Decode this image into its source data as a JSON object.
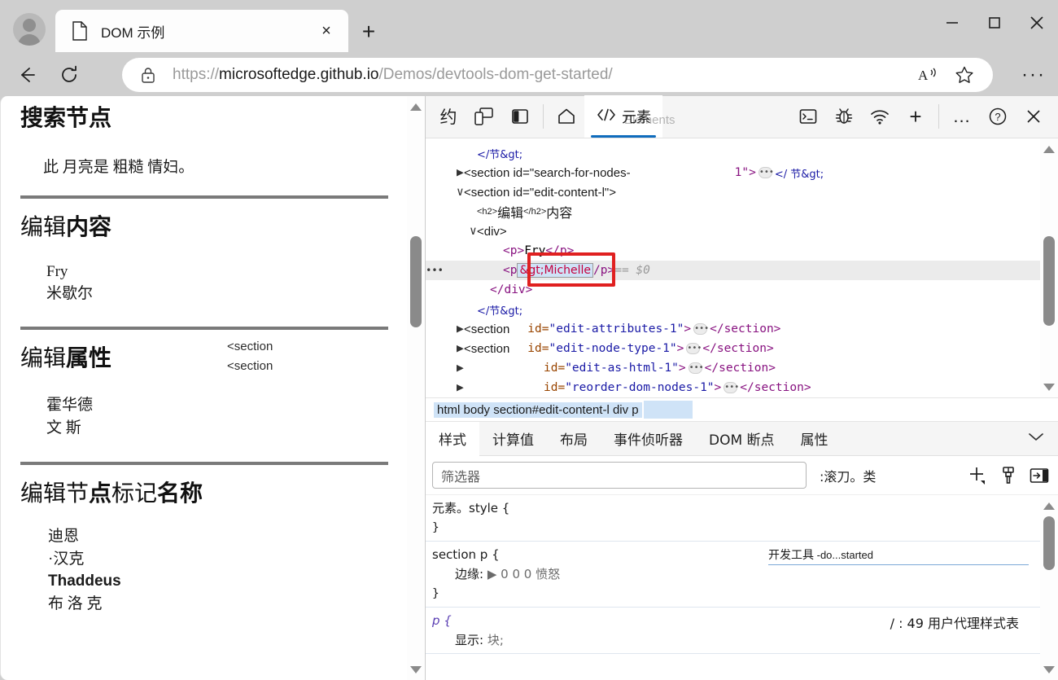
{
  "window": {
    "minimize_label": "minimize",
    "maximize_label": "maximize",
    "close_label": "close"
  },
  "tab": {
    "title": "DOM 示例",
    "close_label": "×",
    "new_tab_label": "+"
  },
  "address_bar": {
    "url_prefix": "https://",
    "url_host": "microsoftedge.github.io",
    "url_path": "/Demos/devtools-dom-get-started/",
    "read_aloud_icon": "read-aloud-icon",
    "favorite_icon": "star-icon",
    "settings_icon": "ellipsis-icon"
  },
  "page": {
    "sections": [
      {
        "heading": "搜索节点",
        "paragraph": "此    月亮是       粗糙    情妇。",
        "lines": []
      },
      {
        "heading_light": "编辑",
        "heading_bold": "内容",
        "lines": [
          "Fry",
          "米歇尔"
        ]
      },
      {
        "heading_light": "编辑",
        "heading_bold": "属性",
        "ghost_labels": [
          "<section",
          "<section"
        ],
        "lines": [
          "霍华德",
          "文 斯"
        ]
      },
      {
        "heading_light": "编辑节",
        "heading_bold2": "点",
        "heading_light2": "标记",
        "heading_bold3": "名称",
        "lines": [
          "迪恩",
          "·汉克",
          "Thaddeus",
          "布 洛 克"
        ]
      }
    ]
  },
  "devtools": {
    "toolbar": {
      "about_label": "约",
      "device_emulation_icon": "device-emulation-icon",
      "dock_side_icon": "dock-side-icon",
      "home_icon": "home-icon",
      "elements_tab_label": "元素",
      "elements_tab_ghost": "Elements",
      "console_icon": "console-icon",
      "debugger_icon": "bug-icon",
      "network_icon": "network-icon",
      "add_tool_label": "+",
      "more_label": "...",
      "help_label": "?",
      "close_label": "×"
    },
    "dom": {
      "rows": [
        {
          "indent": 2,
          "twisty": "",
          "parts": [
            {
              "t": "cn-blue",
              "v": "</节&gt;"
            }
          ]
        },
        {
          "indent": 1,
          "twisty": "▶",
          "parts": [
            {
              "t": "tag",
              "v": "<section id=\"search-for-nodes-"
            },
            {
              "t": "spacer",
              "v": ""
            },
            {
              "t": "punc",
              "v": "1\">"
            },
            {
              "t": "ell",
              "v": "•••"
            },
            {
              "t": "cn-blue",
              "v": "</ 节&gt;"
            }
          ]
        },
        {
          "indent": 1,
          "twisty": "∨",
          "parts": [
            {
              "t": "tag",
              "v": "<section id=\"edit-content-l\">"
            }
          ]
        },
        {
          "indent": 2,
          "twisty": "",
          "parts": [
            {
              "t": "tagsm",
              "v": "<h2>"
            },
            {
              "t": "cnbig",
              "v": "编辑"
            },
            {
              "t": "tagsm",
              "v": "</h2>"
            },
            {
              "t": "cnbig",
              "v": " 内容"
            }
          ]
        },
        {
          "indent": 2,
          "twisty": "∨",
          "parts": [
            {
              "t": "tag",
              "v": "<div>"
            }
          ]
        },
        {
          "indent": 4,
          "twisty": "",
          "parts": [
            {
              "t": "tag-mono",
              "v": "<p>"
            },
            {
              "t": "plain",
              "v": "Fry"
            },
            {
              "t": "tag-mono",
              "v": "</p>"
            }
          ]
        },
        {
          "indent": 4,
          "twisty": "",
          "selected": true,
          "parts": [
            {
              "t": "tag-mono",
              "v": "<p"
            },
            {
              "t": "editbox",
              "v": "&gt;Michelle"
            },
            {
              "t": "tag-mono",
              "v": "/p>"
            },
            {
              "t": "gray",
              "v": "  ==  $0"
            }
          ]
        },
        {
          "indent": 3,
          "twisty": "",
          "parts": [
            {
              "t": "tag-mono",
              "v": "</div>"
            }
          ]
        },
        {
          "indent": 2,
          "twisty": "",
          "parts": [
            {
              "t": "cn-blue",
              "v": "</节&gt;"
            }
          ]
        },
        {
          "indent": 1,
          "twisty": "▶",
          "parts": [
            {
              "t": "tag",
              "v": "<section"
            },
            {
              "t": "gap",
              "v": ""
            },
            {
              "t": "attr",
              "v": "id="
            },
            {
              "t": "val",
              "v": "\"edit-attributes-1\""
            },
            {
              "t": "punc",
              "v": ">"
            },
            {
              "t": "ell",
              "v": "•••"
            },
            {
              "t": "punc",
              "v": "</section>"
            }
          ]
        },
        {
          "indent": 1,
          "twisty": "▶",
          "parts": [
            {
              "t": "tag",
              "v": "<section"
            },
            {
              "t": "gap",
              "v": ""
            },
            {
              "t": "attr",
              "v": "id="
            },
            {
              "t": "val",
              "v": "\"edit-node-type-1\""
            },
            {
              "t": "punc",
              "v": ">"
            },
            {
              "t": "ell",
              "v": "•••"
            },
            {
              "t": "punc",
              "v": "</section>"
            }
          ]
        },
        {
          "indent": 1,
          "twisty": "▶",
          "parts": [
            {
              "t": "gapwide",
              "v": ""
            },
            {
              "t": "attr",
              "v": "id="
            },
            {
              "t": "val",
              "v": "\"edit-as-html-1\""
            },
            {
              "t": "punc",
              "v": ">"
            },
            {
              "t": "ell",
              "v": "•••"
            },
            {
              "t": "punc",
              "v": "</section>"
            }
          ]
        },
        {
          "indent": 1,
          "twisty": "▶",
          "parts": [
            {
              "t": "gapwide",
              "v": ""
            },
            {
              "t": "attr",
              "v": "id="
            },
            {
              "t": "val",
              "v": "\"reorder-dom-nodes-1\""
            },
            {
              "t": "punc",
              "v": ">"
            },
            {
              "t": "ell",
              "v": "•••"
            },
            {
              "t": "punc",
              "v": "</section>"
            }
          ]
        }
      ]
    },
    "breadcrumb": "html body section#edit-content-l div p",
    "styles_tabs": [
      {
        "label": "样式",
        "active": true
      },
      {
        "label": "计算值",
        "active": false
      },
      {
        "label": "布局",
        "active": false
      },
      {
        "label": "事件侦听器",
        "active": false
      },
      {
        "label": "DOM 断点",
        "active": false
      },
      {
        "label": "属性",
        "active": false
      }
    ],
    "filter": {
      "placeholder": "筛选器",
      "value": "",
      "hov_label": ":滚刀。类",
      "new_rule_icon": "plus-icon",
      "pin_icon": "brush-icon",
      "toggle_icon": "panel-toggle-icon"
    },
    "rules": [
      {
        "selector": "元素。style {",
        "declarations": [],
        "close": "}",
        "source": ""
      },
      {
        "selector": "section p {",
        "declarations": [
          {
            "name": "边缘:",
            "value": "▶ 0 0 0 愤怒"
          }
        ],
        "close": "}",
        "source_link_cn": "开发工具",
        "source_link_tail": " -do...started"
      },
      {
        "selector": "p {",
        "selector_italic": true,
        "declarations": [
          {
            "name": "显示:",
            "value": "块;"
          }
        ],
        "close": "",
        "source_plain": "/ : 49 用户代理样式表"
      }
    ]
  },
  "colors": {
    "accent": "#0f6cbd",
    "selection_highlight": "#cfe3f7",
    "edit_box_text": "#c5003e",
    "red_frame": "#e02020",
    "attr_name": "#994500",
    "attr_value": "#1a1aa6",
    "tag_punct": "#881280"
  }
}
